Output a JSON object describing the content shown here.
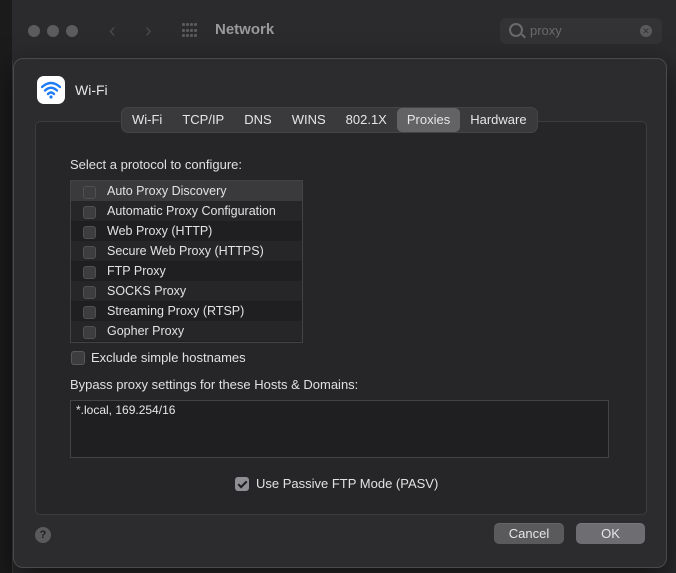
{
  "window": {
    "title": "Network",
    "search_value": "proxy"
  },
  "interface": {
    "name": "Wi-Fi",
    "icon": "wifi-icon"
  },
  "tabs": [
    {
      "label": "Wi-Fi",
      "active": false
    },
    {
      "label": "TCP/IP",
      "active": false
    },
    {
      "label": "DNS",
      "active": false
    },
    {
      "label": "WINS",
      "active": false
    },
    {
      "label": "802.1X",
      "active": false
    },
    {
      "label": "Proxies",
      "active": true
    },
    {
      "label": "Hardware",
      "active": false
    }
  ],
  "proxies": {
    "select_label": "Select a protocol to configure:",
    "protocols": [
      {
        "label": "Auto Proxy Discovery",
        "checked": false
      },
      {
        "label": "Automatic Proxy Configuration",
        "checked": false
      },
      {
        "label": "Web Proxy (HTTP)",
        "checked": false
      },
      {
        "label": "Secure Web Proxy (HTTPS)",
        "checked": false
      },
      {
        "label": "FTP Proxy",
        "checked": false
      },
      {
        "label": "SOCKS Proxy",
        "checked": false
      },
      {
        "label": "Streaming Proxy (RTSP)",
        "checked": false
      },
      {
        "label": "Gopher Proxy",
        "checked": false
      }
    ],
    "exclude_simple": {
      "label": "Exclude simple hostnames",
      "checked": false
    },
    "bypass_label": "Bypass proxy settings for these Hosts & Domains:",
    "bypass_value": "*.local, 169.254/16",
    "passive_ftp": {
      "label": "Use Passive FTP Mode (PASV)",
      "checked": true
    }
  },
  "buttons": {
    "help": "?",
    "cancel": "Cancel",
    "ok": "OK"
  },
  "colors": {
    "sheet_bg": "#2c2c2e",
    "active_tab": "#636366"
  }
}
